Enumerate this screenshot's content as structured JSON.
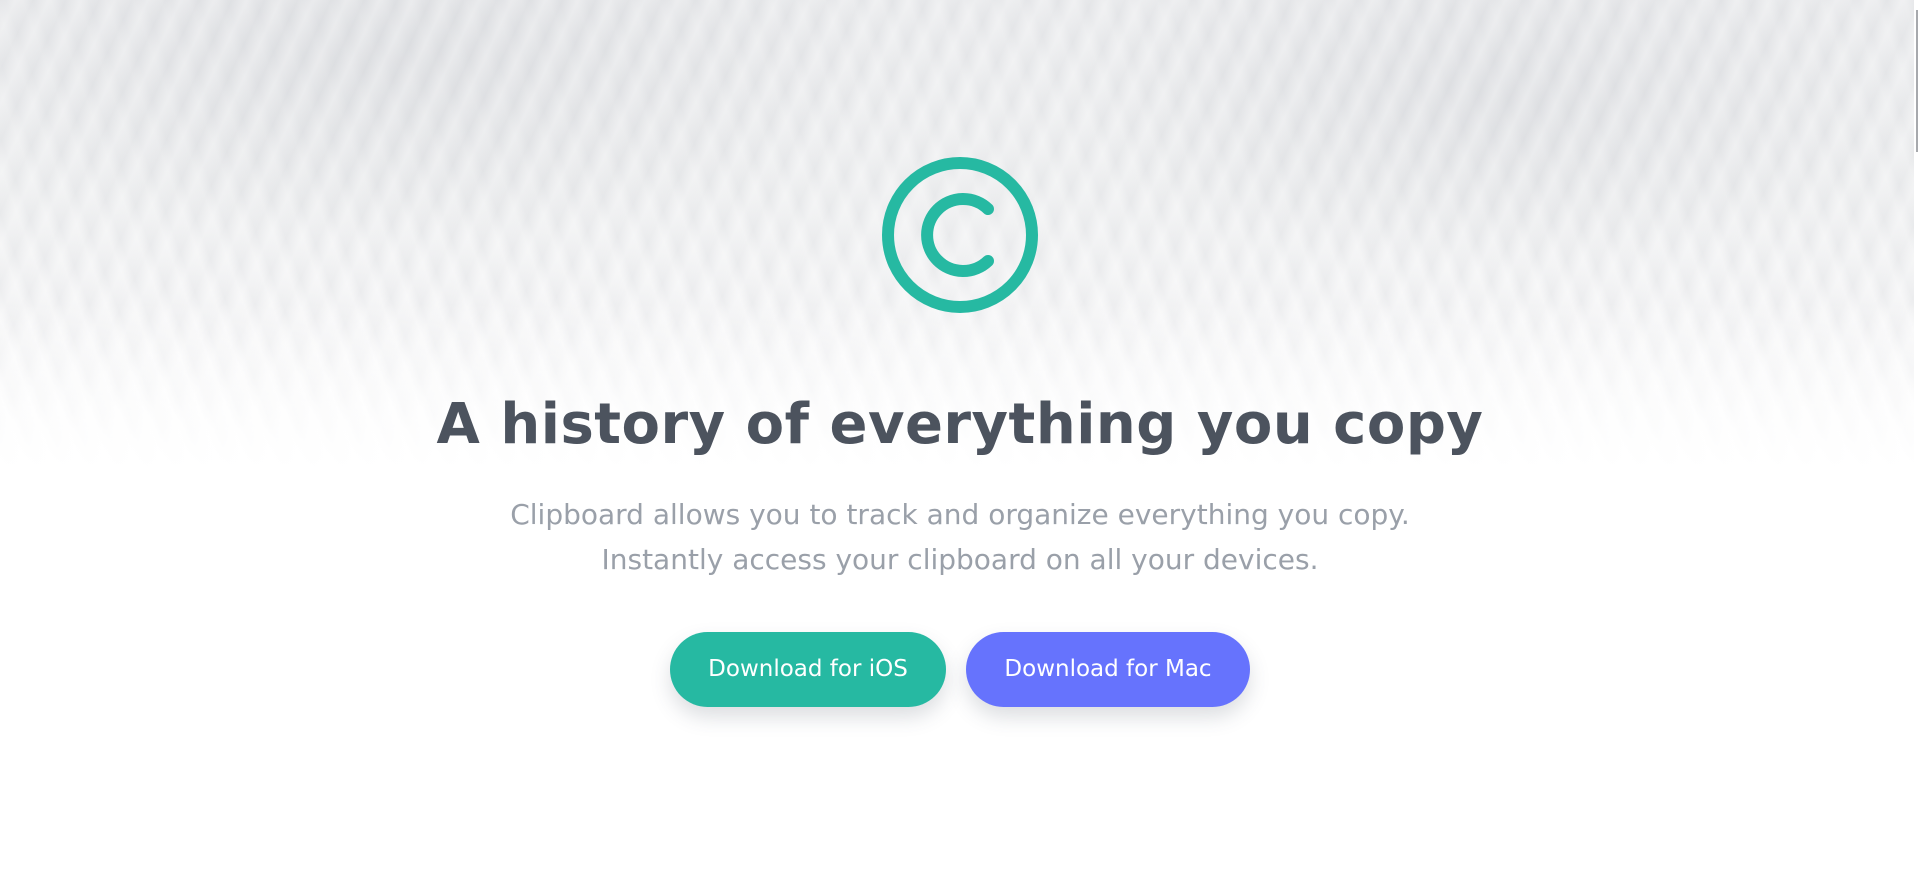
{
  "hero": {
    "logo_icon": "copyright-circle-icon",
    "accent_color": "#26b9a2",
    "headline": "A history of everything you copy",
    "subtitle_line1": "Clipboard allows you to track and organize everything you copy.",
    "subtitle_line2": "Instantly access your clipboard on all your devices."
  },
  "actions": {
    "ios_label": "Download for iOS",
    "ios_color": "#26b9a2",
    "mac_label": "Download for Mac",
    "mac_color": "#6673fd"
  }
}
